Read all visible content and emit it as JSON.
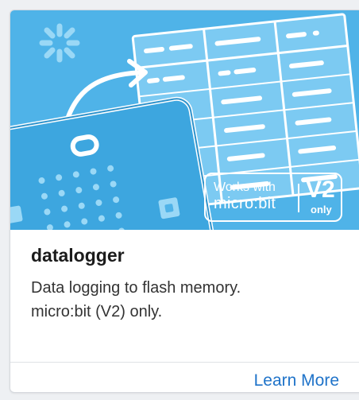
{
  "card": {
    "title": "datalogger",
    "description_lines": [
      "Data logging to flash memory.",
      "micro:bit (V2) only."
    ],
    "learn_more": "Learn More",
    "badge": {
      "works_with": "Works with",
      "product": "micro:bit",
      "version": "V2",
      "qualifier": "only"
    }
  },
  "colors": {
    "hero_background": "#4fb3e8",
    "table_fill": "#7ccaf2",
    "link": "#1f73c9",
    "title": "#1b1b1b"
  }
}
